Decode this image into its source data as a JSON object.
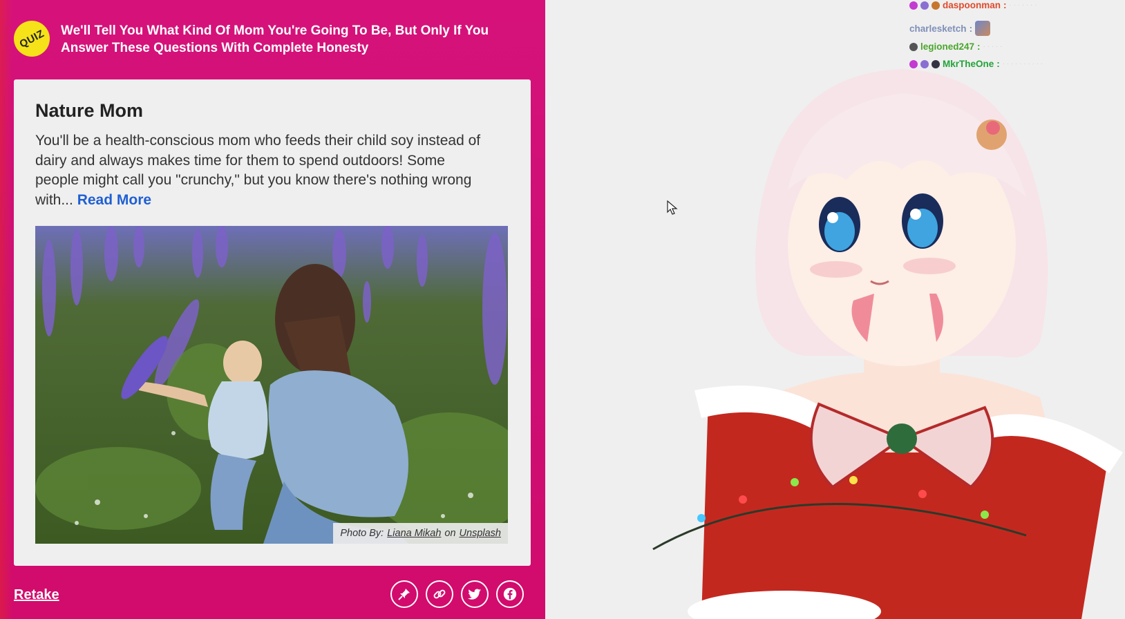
{
  "quiz": {
    "badge": "QUIZ",
    "title": "We'll Tell You What Kind Of Mom You're Going To Be, But Only If You Answer These Questions With Complete Honesty",
    "result_title": "Nature Mom",
    "result_text": "You'll be a health-conscious mom who feeds their child soy instead of dairy and always makes time for them to spend outdoors! Some people might call you \"crunchy,\" but you know there's nothing wrong with... ",
    "read_more": "Read More",
    "photo_caption": {
      "prefix": "Photo By:",
      "author": "Liana Mikah",
      "on": "on",
      "source": "Unsplash"
    },
    "retake": "Retake",
    "share_buttons": [
      {
        "name": "pin-icon"
      },
      {
        "name": "link-icon"
      },
      {
        "name": "twitter-icon"
      },
      {
        "name": "facebook-icon"
      }
    ]
  },
  "chat": {
    "lines": [
      {
        "user": "daspoonman",
        "color": "#e04a2c"
      },
      {
        "user": "charlesketch",
        "color": "#7f8fb8"
      },
      {
        "user": "legioned247",
        "color": "#4aa62c"
      },
      {
        "user": "MkrTheOne",
        "color": "#22a33a"
      }
    ]
  },
  "colors": {
    "quiz_bg": "#cc0e74",
    "badge": "#f5e218",
    "link": "#1f5fd3"
  }
}
